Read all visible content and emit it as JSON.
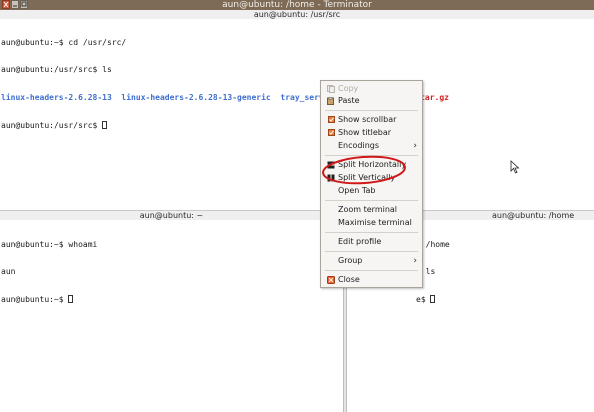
{
  "window": {
    "title": "aun@ubuntu: /home - Terminator"
  },
  "top_pane": {
    "title": "aun@ubuntu: /usr/src",
    "line1": "aun@ubuntu:~$ cd /usr/src/",
    "line2": "aun@ubuntu:/usr/src$ ls",
    "files": [
      {
        "name": "linux-headers-2.6.28-13",
        "color": "#3f6fd0"
      },
      {
        "name": "linux-headers-2.6.28-13-generic",
        "color": "#3f6fd0"
      },
      {
        "name": "tray_services",
        "color": "#3f6fd0"
      },
      {
        "name": "tray_services.tar.gz",
        "color": "#d32020"
      }
    ],
    "line4": "aun@ubuntu:/usr/src$ "
  },
  "bottom_left_pane": {
    "title": "aun@ubuntu: ~",
    "line1": "aun@ubuntu:~$ whoami",
    "line2": "aun",
    "line3": "aun@ubuntu:~$ "
  },
  "bottom_right_pane": {
    "title": "aun@ubuntu: /home",
    "line1": "d /home",
    "line2": "$ ls",
    "line3": "e$ "
  },
  "context_menu": {
    "copy": "Copy",
    "paste": "Paste",
    "show_scrollbar": "Show scrollbar",
    "show_titlebar": "Show titlebar",
    "encodings": "Encodings",
    "split_horizontally": "Split Horizontally",
    "split_vertically": "Split Vertically",
    "open_tab": "Open Tab",
    "zoom_terminal": "Zoom terminal",
    "maximise_terminal": "Maximise terminal",
    "edit_profile": "Edit profile",
    "group": "Group",
    "close": "Close"
  },
  "icons": {
    "copy": "copy-icon",
    "paste": "paste-icon",
    "checkbox": "checkbox-checked-icon",
    "split_h": "split-horizontal-icon",
    "split_v": "split-vertical-icon",
    "close": "close-icon",
    "submenu": "chevron-right-icon",
    "pointer": "mouse-pointer-icon"
  },
  "colors": {
    "titlebar": "#7d6a57",
    "highlight_ring": "#d01818",
    "dir_blue": "#3f6fd0",
    "archive_red": "#d32020"
  }
}
